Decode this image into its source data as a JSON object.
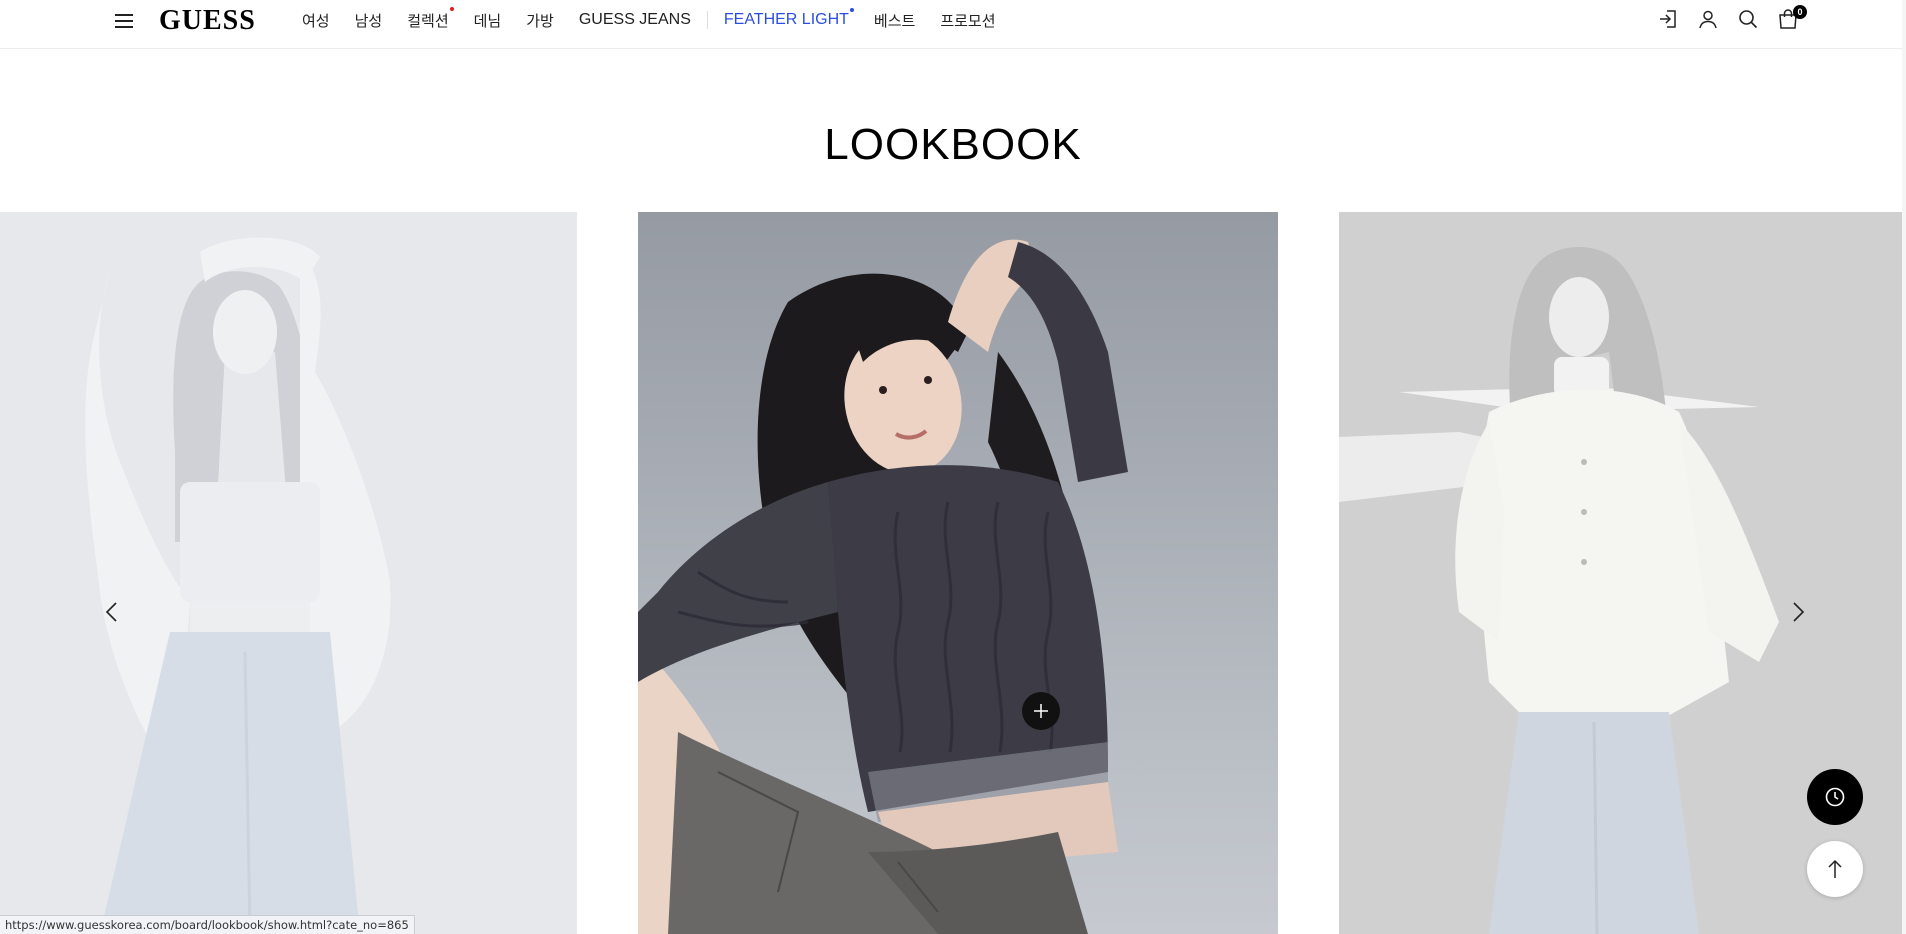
{
  "header": {
    "logo": "GUESS",
    "nav": [
      {
        "label": "여성",
        "accent": false,
        "dot": false
      },
      {
        "label": "남성",
        "accent": false,
        "dot": false
      },
      {
        "label": "컬렉션",
        "accent": false,
        "dot": true
      },
      {
        "label": "데님",
        "accent": false,
        "dot": false
      },
      {
        "label": "가방",
        "accent": false,
        "dot": false
      },
      {
        "label": "GUESS JEANS",
        "accent": false,
        "dot": false
      },
      {
        "label": "FEATHER LIGHT",
        "accent": true,
        "dot": true
      },
      {
        "label": "베스트",
        "accent": false,
        "dot": false
      },
      {
        "label": "프로모션",
        "accent": false,
        "dot": false
      }
    ],
    "icons": [
      "login-icon",
      "user-icon",
      "search-icon",
      "shopping-bag-icon"
    ],
    "cart_count": "0"
  },
  "colors": {
    "accent": "#2b4ee0",
    "collection_dot": "#e02020",
    "feather_dot": "#2b4ee0"
  },
  "main": {
    "title": "LOOKBOOK",
    "slides": [
      {
        "name": "lookbook-slide-prev",
        "state": "dimmed"
      },
      {
        "name": "lookbook-slide-active",
        "state": "active"
      },
      {
        "name": "lookbook-slide-next",
        "state": "dimmed"
      }
    ]
  },
  "floating": {
    "recent_icon": "clock-icon",
    "top_icon": "arrow-up-icon"
  },
  "status_bar": {
    "url": "https://www.guesskorea.com/board/lookbook/show.html?cate_no=865"
  }
}
